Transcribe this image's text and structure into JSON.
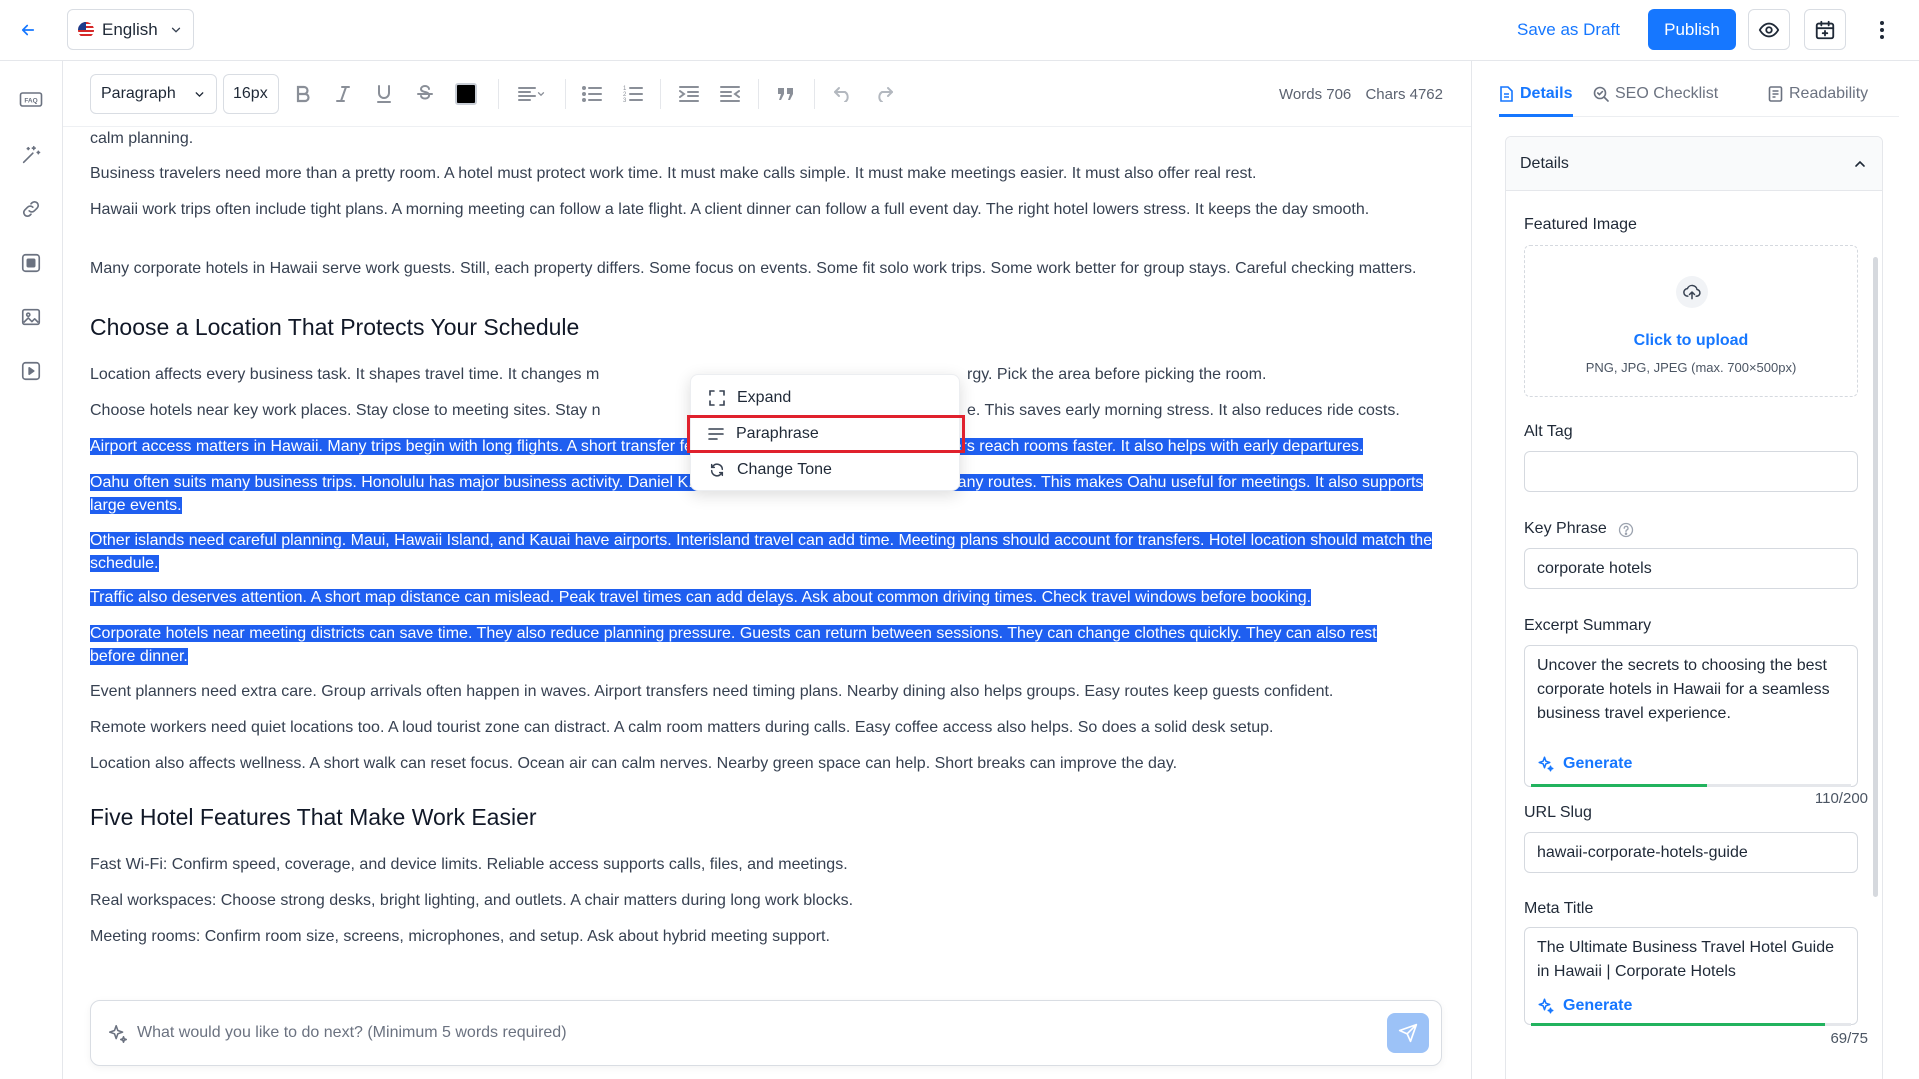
{
  "header": {
    "language": "English",
    "save_draft": "Save as Draft",
    "publish": "Publish"
  },
  "toolbar": {
    "block_type": "Paragraph",
    "font_size": "16px",
    "words_label": "Words 706",
    "chars_label": "Chars 4762"
  },
  "content": {
    "p0": "calm planning.",
    "p1": "Business travelers need more than a pretty room. A hotel must protect work time. It must make calls simple. It must make meetings easier. It must also offer real rest.",
    "p2": "Hawaii work trips often include tight plans. A morning meeting can follow a late flight. A client dinner can follow a full event day. The right hotel lowers stress. It keeps the day smooth.",
    "p3": "Many corporate hotels in Hawaii serve work guests. Still, each property differs. Some focus on events. Some fit solo work trips. Some work better for group stays. Careful checking matters.",
    "h1": "Choose a Location That Protects Your Schedule",
    "p4a": "Location affects every business task. It shapes travel time. It changes m",
    "p4b": "rgy. Pick the area before picking the room.",
    "p5a": "Choose hotels near key work places. Stay close to meeting sites. Stay n",
    "p5b": "e. This saves early morning stress. It also reduces ride costs.",
    "s1": "Airport access matters in Hawaii. Many trips begin with long flights. A short transfer feels valuable afterward. It helps travelers reach rooms faster. It also helps with early departures.",
    "s2": "Oahu often suits many business trips. Honolulu has major business activity. Daniel K. Inouye International Airport serves many routes. This makes Oahu useful for meetings. It also supports large events.",
    "s3": "Other islands need careful planning. Maui, Hawaii Island, and Kauai have airports. Interisland travel can add time. Meeting plans should account for transfers. Hotel location should match the schedule.",
    "s4": "Traffic also deserves attention. A short map distance can mislead. Peak travel times can add delays. Ask about common driving times. Check travel windows before booking.",
    "s5": "Corporate hotels near meeting districts can save time. They also reduce planning pressure. Guests can return between sessions. They can change clothes quickly. They can also rest before dinner.",
    "p6": "Event planners need extra care. Group arrivals often happen in waves. Airport transfers need timing plans. Nearby dining also helps groups. Easy routes keep guests confident.",
    "p7": "Remote workers need quiet locations too. A loud tourist zone can distract. A calm room matters during calls. Easy coffee access also helps. So does a solid desk setup.",
    "p8": "Location also affects wellness. A short walk can reset focus. Ocean air can calm nerves. Nearby green space can help. Short breaks can improve the day.",
    "h2": "Five Hotel Features That Make Work Easier",
    "p9": "Fast Wi-Fi: Confirm speed, coverage, and device limits. Reliable access supports calls, files, and meetings.",
    "p10": "Real workspaces: Choose strong desks, bright lighting, and outlets. A chair matters during long work blocks.",
    "p11": "Meeting rooms: Confirm room size, screens, microphones, and setup. Ask about hybrid meeting support."
  },
  "ai_menu": {
    "expand": "Expand",
    "paraphrase": "Paraphrase",
    "change_tone": "Change Tone"
  },
  "prompt": {
    "placeholder": "What would you like to do next? (Minimum 5 words required)"
  },
  "panel": {
    "tabs": {
      "details": "Details",
      "seo": "SEO Checklist",
      "readability": "Readability"
    },
    "card_title": "Details",
    "featured_image_label": "Featured Image",
    "upload_link": "Click to upload",
    "upload_hint": "PNG, JPG, JPEG (max. 700×500px)",
    "alt_tag_label": "Alt Tag",
    "alt_tag_value": "",
    "key_phrase_label": "Key Phrase",
    "key_phrase_value": "corporate hotels",
    "excerpt_label": "Excerpt Summary",
    "excerpt_value": "Uncover the secrets to choosing the best corporate hotels in Hawaii for a seamless business travel experience.",
    "generate_label": "Generate",
    "excerpt_count": "110/200",
    "excerpt_progress": 0.55,
    "slug_label": "URL Slug",
    "slug_value": "hawaii-corporate-hotels-guide",
    "meta_title_label": "Meta Title",
    "meta_title_value": "The Ultimate Business Travel Hotel Guide in Hawaii | Corporate Hotels",
    "meta_title_count": "69/75",
    "meta_title_progress": 0.92
  },
  "colors": {
    "accent": "#1677ff",
    "selection": "#1f5ff0",
    "highlight_border": "#e0212d",
    "progress": "#22b35e"
  }
}
